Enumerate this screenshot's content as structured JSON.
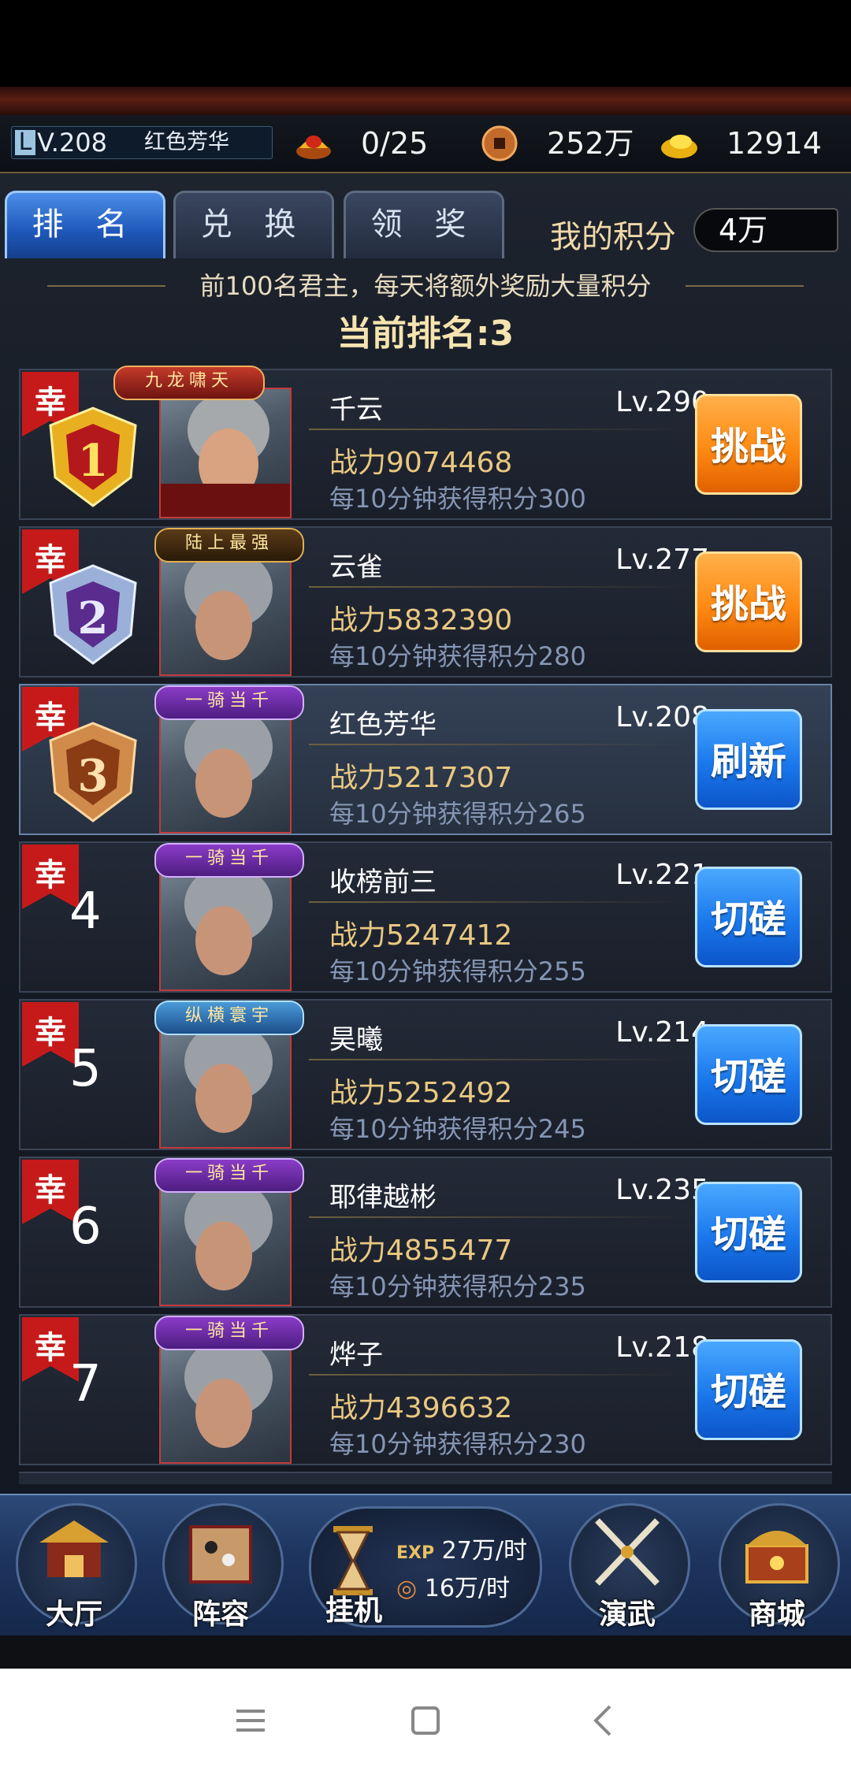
{
  "status": {
    "level": "V.208",
    "level_prefix": "L",
    "player_name": "红色芳华",
    "ingot_count": "0/25",
    "copper": "252万",
    "gold": "12914"
  },
  "tabs": [
    {
      "label": "排 名",
      "active": true
    },
    {
      "label": "兑 换",
      "active": false
    },
    {
      "label": "领 奖",
      "active": false
    }
  ],
  "my_score": {
    "label": "我的积分",
    "value": "4万"
  },
  "notice": "前100名君主，每天将额外奖励大量积分",
  "current_rank": {
    "label": "当前排名:",
    "value": "3"
  },
  "luck_label": "幸",
  "rows": [
    {
      "rank": "1",
      "title": "九龙啸天",
      "name": "千云",
      "level": "Lv.290",
      "power": "战力9074468",
      "score": "每10分钟获得积分300",
      "action": "挑战",
      "action_color": "orange"
    },
    {
      "rank": "2",
      "title": "陆上最强",
      "name": "云雀",
      "level": "Lv.277",
      "power": "战力5832390",
      "score": "每10分钟获得积分280",
      "action": "挑战",
      "action_color": "orange"
    },
    {
      "rank": "3",
      "title": "一骑当千",
      "name": "红色芳华",
      "level": "Lv.208",
      "power": "战力5217307",
      "score": "每10分钟获得积分265",
      "action": "刷新",
      "action_color": "blue"
    },
    {
      "rank": "4",
      "title": "一骑当千",
      "name": "收榜前三",
      "level": "Lv.221",
      "power": "战力5247412",
      "score": "每10分钟获得积分255",
      "action": "切磋",
      "action_color": "blue"
    },
    {
      "rank": "5",
      "title": "纵横寰宇",
      "name": "昊曦",
      "level": "Lv.214",
      "power": "战力5252492",
      "score": "每10分钟获得积分245",
      "action": "切磋",
      "action_color": "blue"
    },
    {
      "rank": "6",
      "title": "一骑当千",
      "name": "耶律越彬",
      "level": "Lv.235",
      "power": "战力4855477",
      "score": "每10分钟获得积分235",
      "action": "切磋",
      "action_color": "blue"
    },
    {
      "rank": "7",
      "title": "一骑当千",
      "name": "烨子",
      "level": "Lv.218",
      "power": "战力4396632",
      "score": "每10分钟获得积分230",
      "action": "切磋",
      "action_color": "blue"
    }
  ],
  "nav": {
    "hall": "大厅",
    "lineup": "阵容",
    "idle": "挂机",
    "exp_label": "EXP",
    "exp_rate": "27万/时",
    "gold_rate": "16万/时",
    "drill": "演武",
    "shop": "商城"
  },
  "colors": {
    "accent_orange": "#ff8a12",
    "accent_blue": "#1a78ec",
    "gold_text": "#e9c880"
  }
}
